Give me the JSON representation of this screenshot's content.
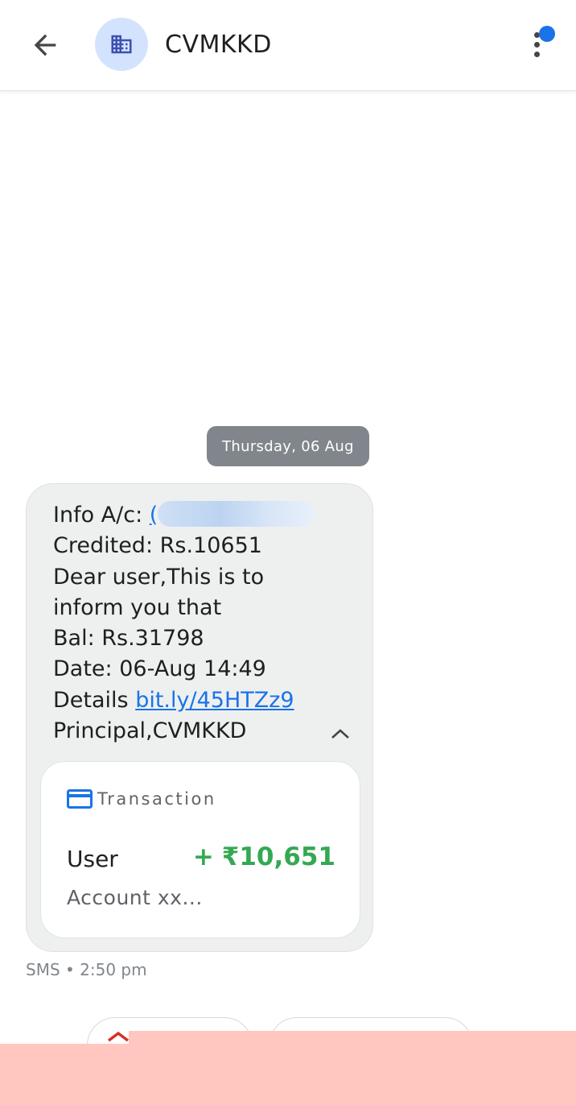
{
  "header": {
    "back_icon": "arrow-back-icon",
    "avatar_icon": "business-building-icon",
    "title": "CVMKKD",
    "menu_icon": "more-vertical-icon"
  },
  "conversation": {
    "date_label": "Thursday, 06 Aug",
    "message": {
      "info_label": "Info A/c:",
      "info_link_start": "(",
      "credited": "Credited: Rs.10651",
      "line_dear": "Dear user,This is to",
      "line_inform": "inform you that",
      "balance": "Bal: Rs.31798",
      "date": "Date: 06-Aug 14:49",
      "details_label": "Details",
      "details_link": "bit.ly/45HTZz9",
      "signature": "Principal,CVMKKD"
    },
    "transaction_card": {
      "icon": "credit-card-icon",
      "header": "Transaction",
      "party": "User",
      "sign": "+",
      "amount": "₹10,651",
      "account": "Account xx...",
      "amount_color": "#34a853"
    },
    "meta": "SMS • 2:50 pm"
  },
  "colors": {
    "accent": "#1a73e8",
    "avatar_bg": "#d3e3fd",
    "bubble_bg": "#eef0f0",
    "chip_bg": "#80868b",
    "credit": "#34a853"
  }
}
